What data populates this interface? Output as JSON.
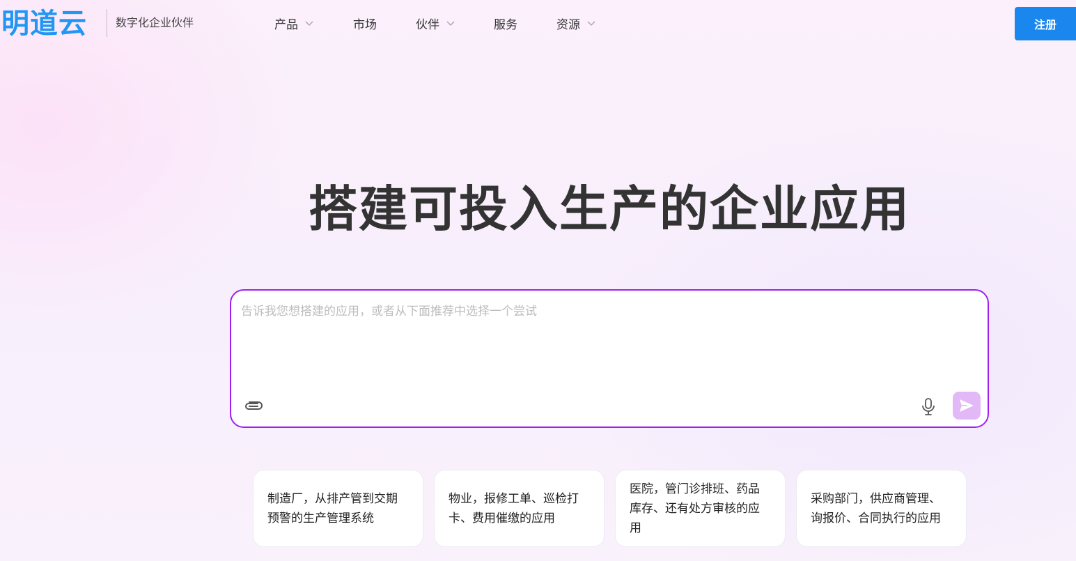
{
  "header": {
    "logo_text": "明道云",
    "tagline": "数字化企业伙伴",
    "nav": [
      {
        "label": "产品",
        "has_dropdown": true
      },
      {
        "label": "市场",
        "has_dropdown": false
      },
      {
        "label": "伙伴",
        "has_dropdown": true
      },
      {
        "label": "服务",
        "has_dropdown": false
      },
      {
        "label": "资源",
        "has_dropdown": true
      }
    ],
    "register_label": "注册"
  },
  "hero": {
    "title": "搭建可投入生产的企业应用"
  },
  "prompt": {
    "placeholder": "告诉我您想搭建的应用，或者从下面推荐中选择一个尝试",
    "value": "",
    "icons": [
      "paperclip-icon",
      "microphone-icon",
      "send-icon"
    ]
  },
  "suggestions": [
    {
      "text": "制造厂，从排产管到交期预警的生产管理系统"
    },
    {
      "text": "物业，报修工单、巡检打卡、费用催缴的应用"
    },
    {
      "text": "医院，管门诊排班、药品库存、还有处方审核的应用"
    },
    {
      "text": "采购部门，供应商管理、询报价、合同执行的应用"
    }
  ],
  "colors": {
    "brand_blue": "#1a87ef",
    "logo_blue": "#2196f3",
    "prompt_border": "#9f1ff0",
    "send_button": "#e2b8f7",
    "title_text": "#333333"
  }
}
